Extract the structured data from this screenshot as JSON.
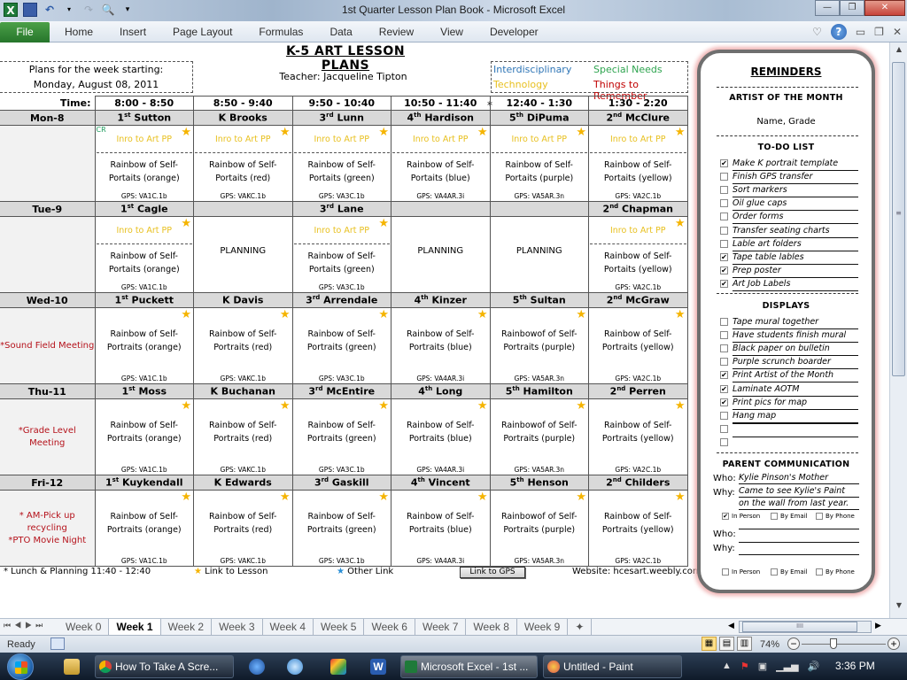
{
  "window": {
    "title": "1st Quarter Lesson Plan Book  -  Microsoft Excel",
    "controls": [
      "minimize",
      "restore",
      "close"
    ]
  },
  "ribbon": {
    "file_label": "File",
    "tabs": [
      "Home",
      "Insert",
      "Page Layout",
      "Formulas",
      "Data",
      "Review",
      "View",
      "Developer"
    ]
  },
  "sheet": {
    "title": "K-5 ART LESSON PLANS",
    "week_label": "Plans for the week starting:",
    "week_date": "Monday, August 08, 2011",
    "teacher": "Teacher: Jacqueline Tipton",
    "legend": {
      "interdisciplinary": "Interdisciplinary",
      "special_needs": "Special Needs",
      "technology": "Technology",
      "things_to_remember": "Things to Remember",
      "colors": {
        "interdisciplinary": "#2e75b6",
        "special_needs": "#2ea44f",
        "technology": "#e8c020",
        "things_to_remember": "#c00000"
      }
    },
    "time_label": "Time:",
    "times": [
      "8:00 - 8:50",
      "8:50 - 9:40",
      "9:50 - 10:40",
      "10:50 - 11:40",
      "12:40 - 1:30",
      "1:30 - 2:20"
    ],
    "lunch_marker": "*",
    "days": [
      {
        "day": "Mon-8",
        "note": "",
        "classes": [
          {
            "grade": "1",
            "sup": "st",
            "teacher": "Sutton",
            "cr": "CR",
            "intro": "Inro to Art PP",
            "lesson1": "Rainbow of Self-",
            "lesson2": "Portaits (orange)",
            "gps": "GPS: VA1C.1b",
            "star": true
          },
          {
            "grade": "K",
            "sup": "",
            "teacher": "Brooks",
            "intro": "Inro to Art PP",
            "lesson1": "Rainbow of Self-",
            "lesson2": "Portaits (red)",
            "gps": "GPS: VAKC.1b",
            "star": true
          },
          {
            "grade": "3",
            "sup": "rd",
            "teacher": "Lunn",
            "intro": "Inro to Art PP",
            "lesson1": "Rainbow of Self-",
            "lesson2": "Portaits (green)",
            "gps": "GPS: VA3C.1b",
            "star": true
          },
          {
            "grade": "4",
            "sup": "th",
            "teacher": "Hardison",
            "intro": "Inro to Art PP",
            "lesson1": "Rainbow of Self-",
            "lesson2": "Portaits (blue)",
            "gps": "GPS: VA4AR.3i",
            "star": true
          },
          {
            "grade": "5",
            "sup": "th",
            "teacher": "DiPuma",
            "intro": "Inro to Art PP",
            "lesson1": "Rainbow of Self-",
            "lesson2": "Portaits (purple)",
            "gps": "GPS: VA5AR.3n",
            "star": true
          },
          {
            "grade": "2",
            "sup": "nd",
            "teacher": "McClure",
            "intro": "Inro to Art PP",
            "lesson1": "Rainbow of Self-",
            "lesson2": "Portaits (yellow)",
            "gps": "GPS: VA2C.1b",
            "star": true
          }
        ]
      },
      {
        "day": "Tue-9",
        "note": "",
        "classes": [
          {
            "grade": "1",
            "sup": "st",
            "teacher": "Cagle",
            "intro": "Inro to Art PP",
            "lesson1": "Rainbow of Self-",
            "lesson2": "Portaits (orange)",
            "gps": "GPS: VA1C.1b",
            "star": true
          },
          {
            "grade": "",
            "sup": "",
            "teacher": "",
            "planning": "PLANNING"
          },
          {
            "grade": "3",
            "sup": "rd",
            "teacher": "Lane",
            "intro": "Inro to Art PP",
            "lesson1": "Rainbow of Self-",
            "lesson2": "Portaits (green)",
            "gps": "GPS: VA3C.1b",
            "star": true
          },
          {
            "grade": "",
            "sup": "",
            "teacher": "",
            "planning": "PLANNING"
          },
          {
            "grade": "",
            "sup": "",
            "teacher": "",
            "planning": "PLANNING"
          },
          {
            "grade": "2",
            "sup": "nd",
            "teacher": "Chapman",
            "intro": "Inro to Art PP",
            "lesson1": "Rainbow of Self-",
            "lesson2": "Portaits (yellow)",
            "gps": "GPS: VA2C.1b",
            "star": true
          }
        ]
      },
      {
        "day": "Wed-10",
        "note": "*Sound Field Meeting",
        "classes": [
          {
            "grade": "1",
            "sup": "st",
            "teacher": "Puckett",
            "lesson1": "Rainbow of Self-",
            "lesson2": "Portraits (orange)",
            "gps": "GPS: VA1C.1b",
            "star": true
          },
          {
            "grade": "K",
            "sup": "",
            "teacher": "Davis",
            "lesson1": "Rainbow of Self-",
            "lesson2": "Portraits (red)",
            "gps": "GPS: VAKC.1b",
            "star": true
          },
          {
            "grade": "3",
            "sup": "rd",
            "teacher": "Arrendale",
            "lesson1": "Rainbow of Self-",
            "lesson2": "Portraits (green)",
            "gps": "GPS: VA3C.1b",
            "star": true
          },
          {
            "grade": "4",
            "sup": "th",
            "teacher": "Kinzer",
            "lesson1": "Rainbow of Self-",
            "lesson2": "Portraits (blue)",
            "gps": "GPS: VA4AR.3i",
            "star": true
          },
          {
            "grade": "5",
            "sup": "th",
            "teacher": "Sultan",
            "lesson1": "Rainbowof of Self-",
            "lesson2": "Portraits (purple)",
            "gps": "GPS: VA5AR.3n",
            "star": true
          },
          {
            "grade": "2",
            "sup": "nd",
            "teacher": "McGraw",
            "lesson1": "Rainbow of Self-",
            "lesson2": "Portraits (yellow)",
            "gps": "GPS: VA2C.1b",
            "star": true
          }
        ]
      },
      {
        "day": "Thu-11",
        "note": "*Grade Level Meeting",
        "classes": [
          {
            "grade": "1",
            "sup": "st",
            "teacher": "Moss",
            "lesson1": "Rainbow of Self-",
            "lesson2": "Portraits (orange)",
            "gps": "GPS: VA1C.1b",
            "star": true
          },
          {
            "grade": "K",
            "sup": "",
            "teacher": "Buchanan",
            "lesson1": "Rainbow of Self-",
            "lesson2": "Portraits (red)",
            "gps": "GPS: VAKC.1b",
            "star": true
          },
          {
            "grade": "3",
            "sup": "rd",
            "teacher": "McEntire",
            "lesson1": "Rainbow of Self-",
            "lesson2": "Portraits (green)",
            "gps": "GPS: VA3C.1b",
            "star": true
          },
          {
            "grade": "4",
            "sup": "th",
            "teacher": "Long",
            "lesson1": "Rainbow of Self-",
            "lesson2": "Portraits (blue)",
            "gps": "GPS: VA4AR.3i",
            "star": true
          },
          {
            "grade": "5",
            "sup": "th",
            "teacher": "Hamilton",
            "lesson1": "Rainbowof of Self-",
            "lesson2": "Portraits (purple)",
            "gps": "GPS: VA5AR.3n",
            "star": true
          },
          {
            "grade": "2",
            "sup": "nd",
            "teacher": "Perren",
            "lesson1": "Rainbow of Self-",
            "lesson2": "Portraits (yellow)",
            "gps": "GPS: VA2C.1b",
            "star": true
          }
        ]
      },
      {
        "day": "Fri-12",
        "note": "* AM-Pick up recycling *PTO Movie Night",
        "note_lines": [
          "* AM-Pick up",
          "recycling",
          "*PTO Movie Night"
        ],
        "classes": [
          {
            "grade": "1",
            "sup": "st",
            "teacher": "Kuykendall",
            "lesson1": "Rainbow of Self-",
            "lesson2": "Portraits (orange)",
            "gps": "GPS: VA1C.1b",
            "star": true
          },
          {
            "grade": "K",
            "sup": "",
            "teacher": "Edwards",
            "lesson1": "Rainbow of Self-",
            "lesson2": "Portraits (red)",
            "gps": "GPS: VAKC.1b",
            "star": true
          },
          {
            "grade": "3",
            "sup": "rd",
            "teacher": "Gaskill",
            "lesson1": "Rainbow of Self-",
            "lesson2": "Portraits (green)",
            "gps": "GPS: VA3C.1b",
            "star": true
          },
          {
            "grade": "4",
            "sup": "th",
            "teacher": "Vincent",
            "lesson1": "Rainbow of Self-",
            "lesson2": "Portraits (blue)",
            "gps": "GPS: VA4AR.3i",
            "star": true
          },
          {
            "grade": "5",
            "sup": "th",
            "teacher": "Henson",
            "lesson1": "Rainbowof of Self-",
            "lesson2": "Portraits (purple)",
            "gps": "GPS: VA5AR.3n",
            "star": true
          },
          {
            "grade": "2",
            "sup": "nd",
            "teacher": "Childers",
            "lesson1": "Rainbow of Self-",
            "lesson2": "Portraits (yellow)",
            "gps": "GPS: VA2C.1b",
            "star": true
          }
        ]
      }
    ],
    "footer": {
      "lunch": "* Lunch & Planning 11:40 - 12:40",
      "link_to_lesson": "Link to Lesson",
      "other_link": "Other Link",
      "gps_button": "Link to GPS",
      "website": "Website: hcesart.weebly.com"
    }
  },
  "reminders": {
    "title": "REMINDERS",
    "artist_heading": "ARTIST OF THE MONTH",
    "artist_value": "Name, Grade",
    "todo_heading": "TO-DO LIST",
    "todo": [
      {
        "text": "Make K portrait template",
        "checked": true
      },
      {
        "text": "Finish GPS transfer",
        "checked": false
      },
      {
        "text": "Sort markers",
        "checked": false
      },
      {
        "text": "Oil glue caps",
        "checked": false
      },
      {
        "text": "Order forms",
        "checked": false
      },
      {
        "text": "Transfer seating charts",
        "checked": false
      },
      {
        "text": "Lable art folders",
        "checked": false
      },
      {
        "text": "Tape table lables",
        "checked": true
      },
      {
        "text": "Prep poster",
        "checked": true
      },
      {
        "text": "Art Job Labels",
        "checked": true
      }
    ],
    "displays_heading": "DISPLAYS",
    "displays": [
      {
        "text": "Tape mural together",
        "checked": false
      },
      {
        "text": "Have students  finish mural",
        "checked": false
      },
      {
        "text": "Black paper on bulletin",
        "checked": false
      },
      {
        "text": "Purple scrunch boarder",
        "checked": false
      },
      {
        "text": "Print Artist  of the  Month",
        "checked": true
      },
      {
        "text": "Laminate AOTM",
        "checked": true
      },
      {
        "text": "Print pics for map",
        "checked": true
      },
      {
        "text": "Hang map",
        "checked": false
      },
      {
        "text": "",
        "checked": false
      },
      {
        "text": "",
        "checked": false
      }
    ],
    "parent_heading": "PARENT COMMUNICATION",
    "who_label": "Who:",
    "why_label": "Why:",
    "entries": [
      {
        "who": "Kylie Pinson's Mother",
        "why1": "Came to see Kylie's Paint",
        "why2": "on the wall from last year.",
        "in_person": true,
        "by_email": false,
        "by_phone": false
      },
      {
        "who": "",
        "why1": "",
        "why2": "",
        "in_person": false,
        "by_email": false,
        "by_phone": false
      }
    ],
    "opt_in_person": "In Person",
    "opt_by_email": "By Email",
    "opt_by_phone": "By Phone"
  },
  "sheet_tabs": {
    "tabs": [
      "Week 0",
      "Week 1",
      "Week 2",
      "Week 3",
      "Week 4",
      "Week 5",
      "Week 6",
      "Week 7",
      "Week 8",
      "Week 9"
    ],
    "active": "Week 1"
  },
  "status": {
    "ready": "Ready",
    "zoom": "74%",
    "zoom_percent": 74
  },
  "taskbar": {
    "items": [
      {
        "label": "How To Take A Scre...",
        "icon": "chrome-icon"
      },
      {
        "label": "Microsoft Excel - 1st ...",
        "icon": "excel-icon",
        "active": true
      },
      {
        "label": "Untitled - Paint",
        "icon": "paint-icon"
      }
    ],
    "clock": "3:36 PM"
  }
}
